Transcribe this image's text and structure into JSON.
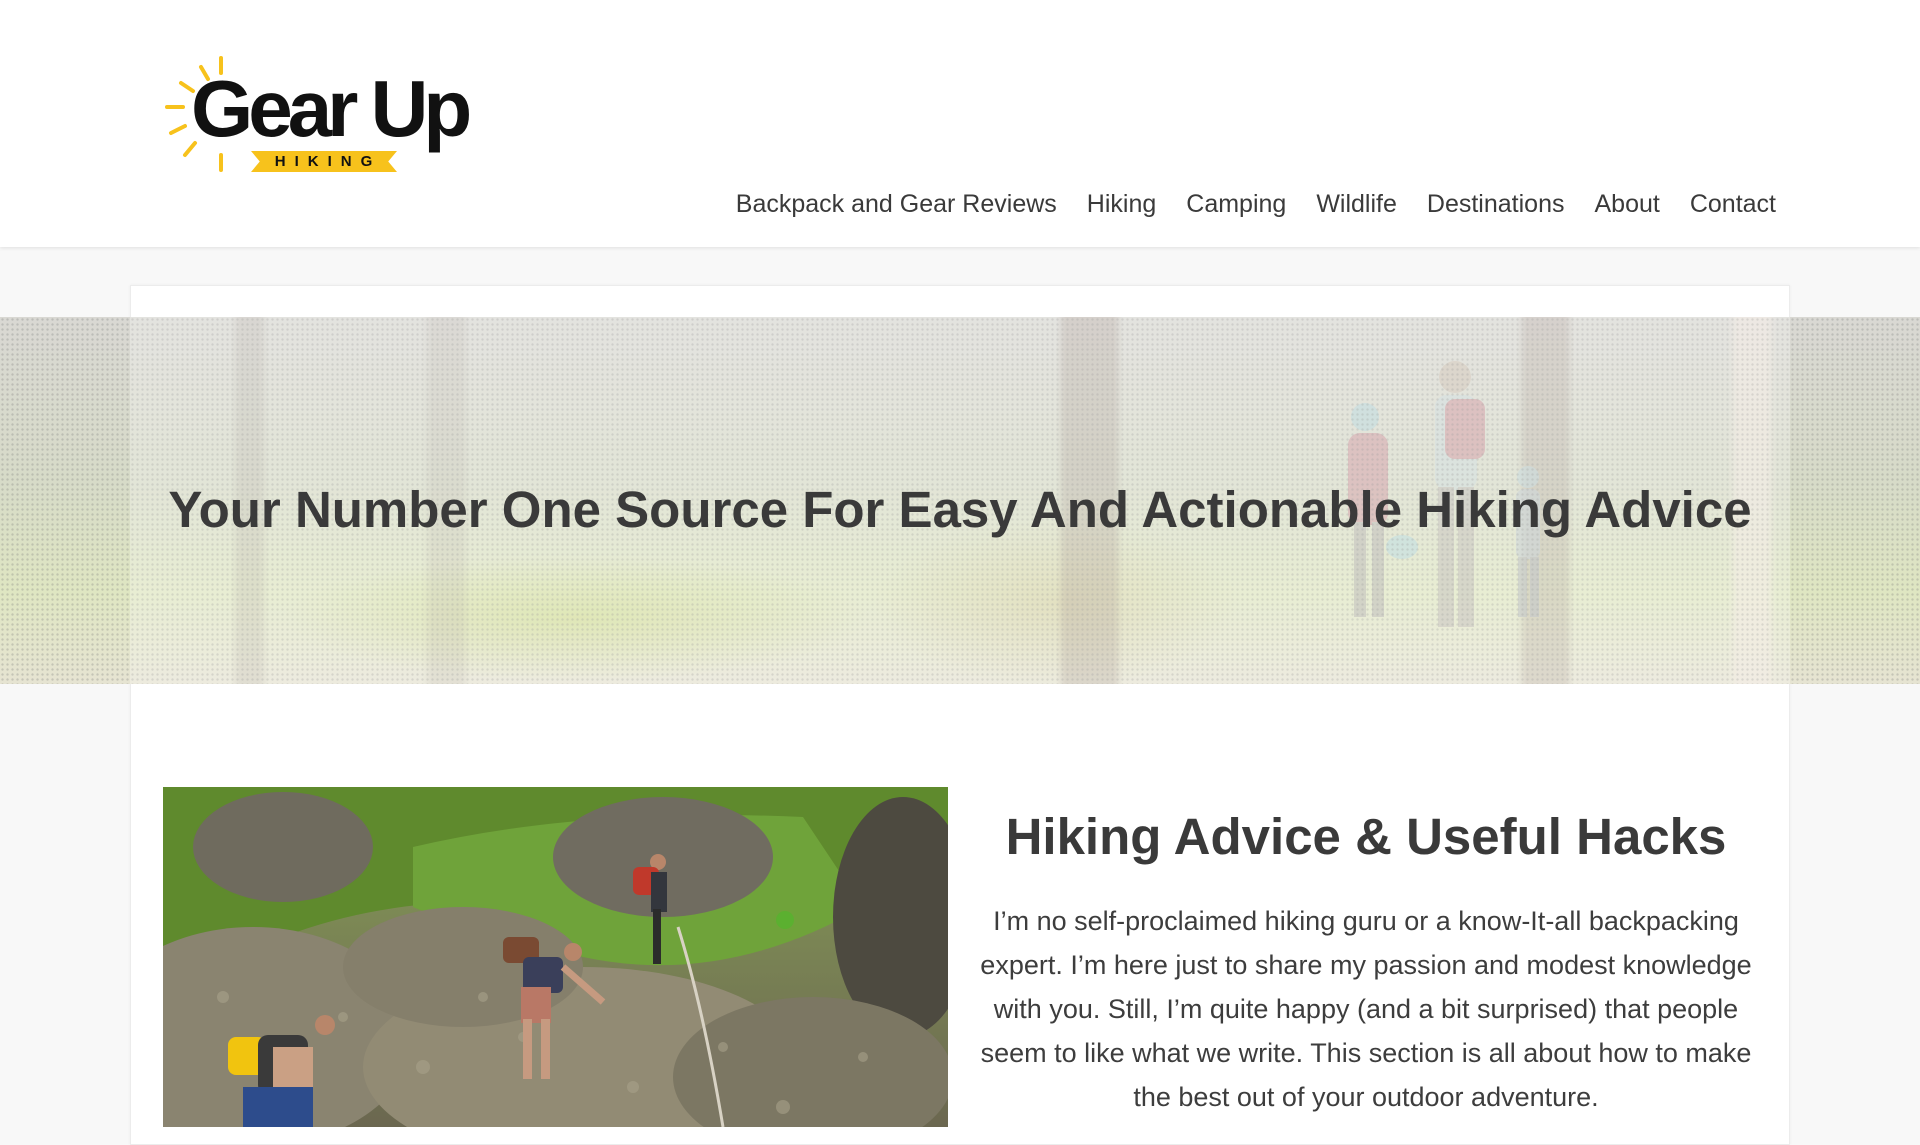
{
  "brand": {
    "name": "Gear Up",
    "tagline": "HIKING",
    "accent_color": "#f7c21c"
  },
  "nav": {
    "items": [
      {
        "label": "Backpack and Gear Reviews"
      },
      {
        "label": "Hiking"
      },
      {
        "label": "Camping"
      },
      {
        "label": "Wildlife"
      },
      {
        "label": "Destinations"
      },
      {
        "label": "About"
      },
      {
        "label": "Contact"
      }
    ]
  },
  "hero": {
    "title": "Your Number One Source For Easy And Actionable Hiking Advice",
    "image_icon": "hikers-in-forest-photo"
  },
  "feature": {
    "image_icon": "hikers-climbing-rocks-photo",
    "heading": "Hiking Advice & Useful Hacks",
    "body": "I’m no self-proclaimed hiking guru or a know-It-all backpacking expert. I’m here just to share my passion and modest knowledge with you. Still, I’m quite happy (and a bit surprised) that people seem to like what we write. This section is all about how to make the best out of your outdoor adventure."
  }
}
